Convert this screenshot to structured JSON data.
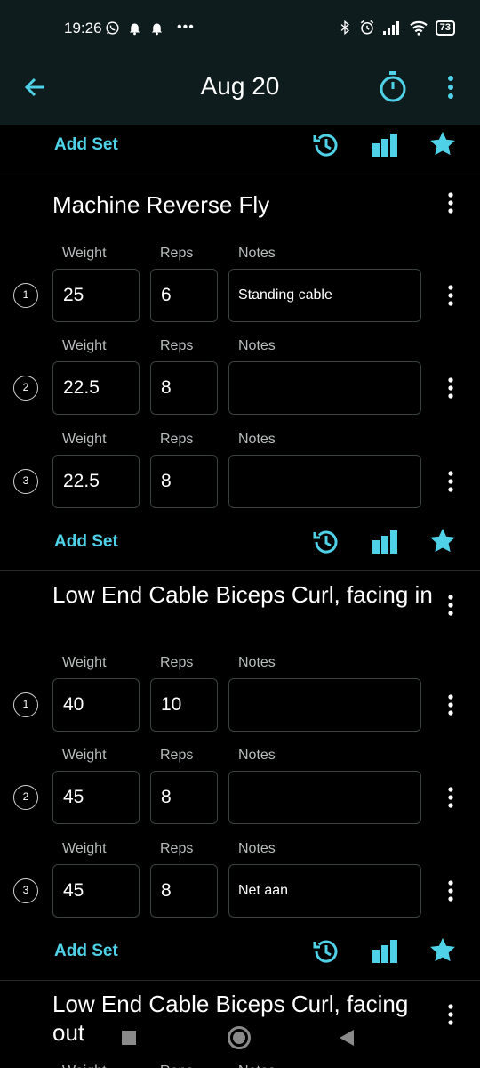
{
  "status_bar": {
    "time": "19:26",
    "left_icons": [
      "whatsapp-icon",
      "bell-icon",
      "bell-icon",
      "more-horizontal-icon"
    ],
    "right_icons": [
      "bluetooth-icon",
      "alarm-icon",
      "signal-icon",
      "wifi-icon"
    ],
    "battery": "73"
  },
  "app_bar": {
    "title": "Aug 20",
    "icons": [
      "back-arrow-icon",
      "stopwatch-icon",
      "more-vertical-icon"
    ]
  },
  "colors": {
    "accent": "#4fd2e8",
    "background": "#000000",
    "app_bar": "#0f1c1e",
    "field_border": "#3b4041",
    "label": "#b8bcbd"
  },
  "labels": {
    "add_set": "Add Set",
    "weight": "Weight",
    "reps": "Reps",
    "notes": "Notes"
  },
  "exercises": [
    {
      "title": "Machine Reverse Fly",
      "sets": [
        {
          "num": "1",
          "weight": "25",
          "reps": "6",
          "notes": "Standing cable"
        },
        {
          "num": "2",
          "weight": "22.5",
          "reps": "8",
          "notes": ""
        },
        {
          "num": "3",
          "weight": "22.5",
          "reps": "8",
          "notes": ""
        }
      ]
    },
    {
      "title": "Low End Cable Biceps Curl, facing in",
      "sets": [
        {
          "num": "1",
          "weight": "40",
          "reps": "10",
          "notes": ""
        },
        {
          "num": "2",
          "weight": "45",
          "reps": "8",
          "notes": ""
        },
        {
          "num": "3",
          "weight": "45",
          "reps": "8",
          "notes": "Net aan"
        }
      ]
    },
    {
      "title": "Low End Cable Biceps Curl, facing out",
      "sets": []
    }
  ],
  "nav_bar": {
    "icons": [
      "recent-apps-icon",
      "home-icon",
      "back-icon"
    ]
  }
}
